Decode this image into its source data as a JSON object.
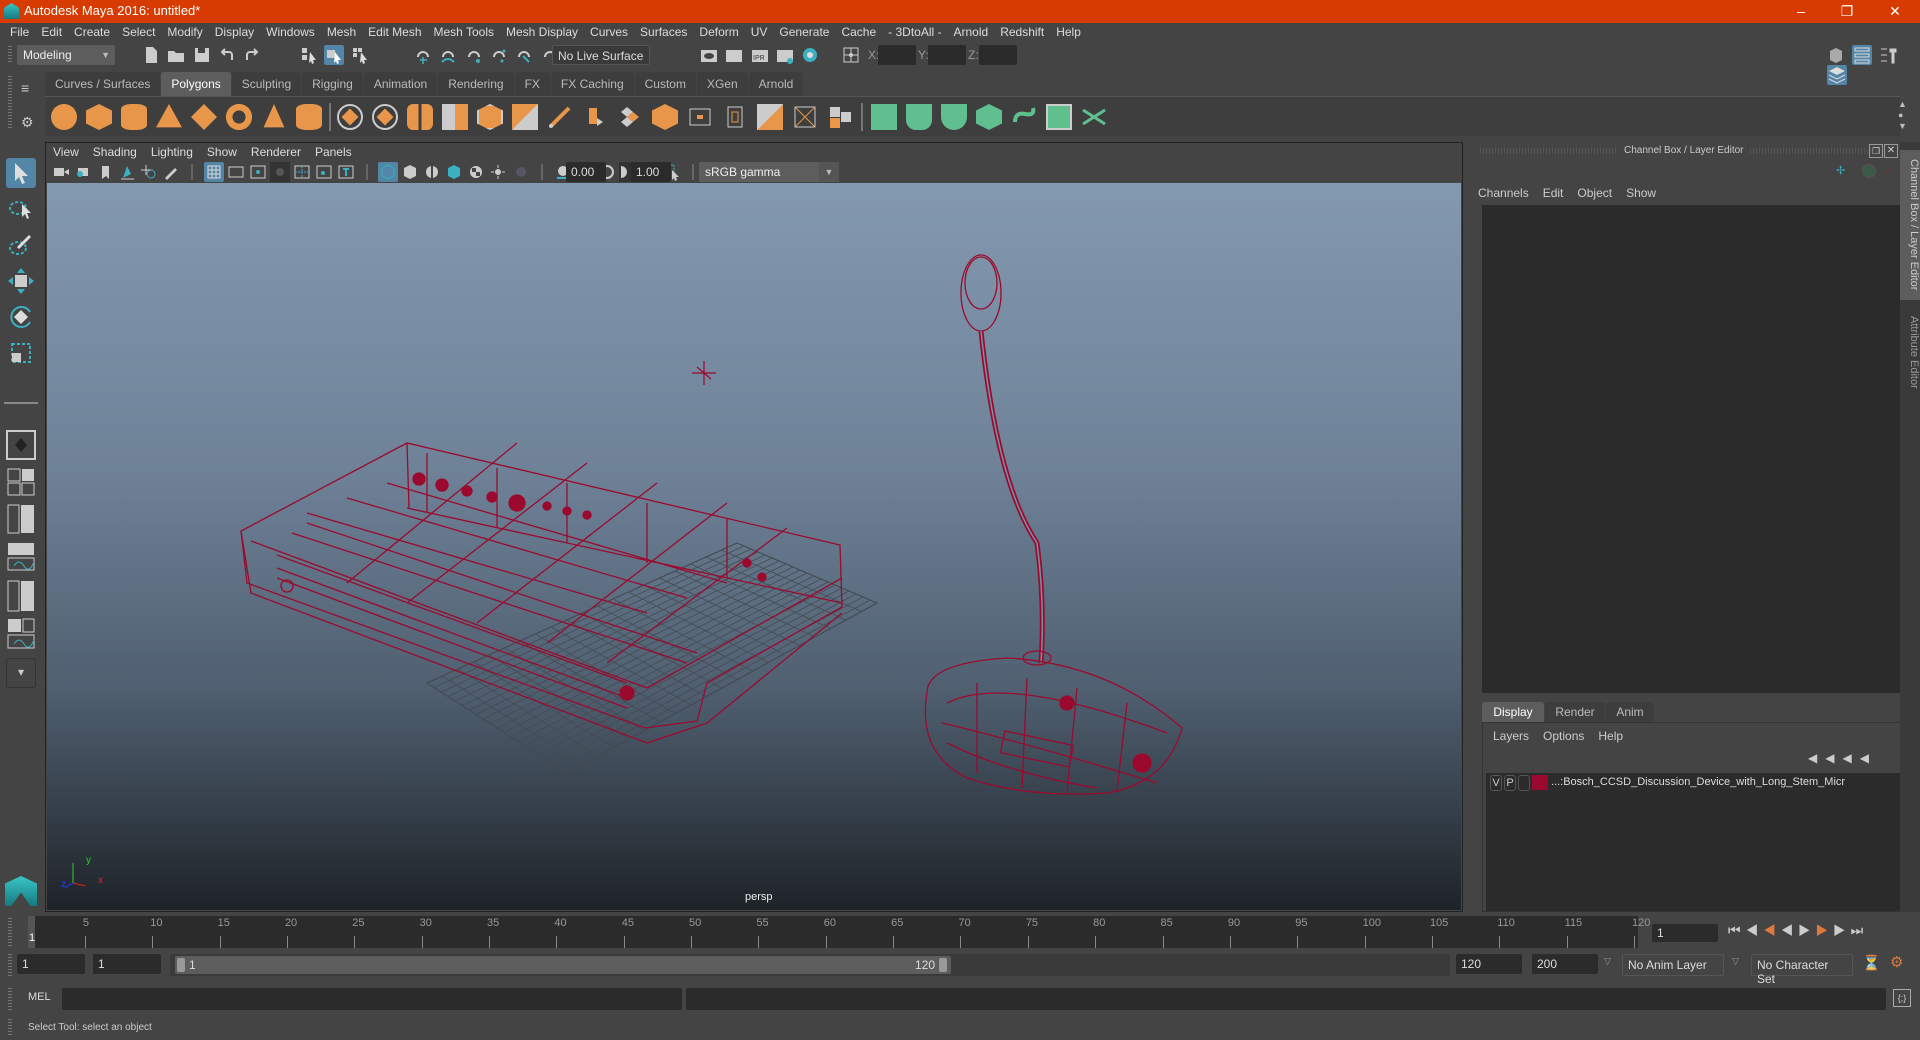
{
  "window": {
    "title": "Autodesk Maya 2016: untitled*",
    "controls": [
      "minimize",
      "restore",
      "close"
    ]
  },
  "menubar": [
    "File",
    "Edit",
    "Create",
    "Select",
    "Modify",
    "Display",
    "Windows",
    "Mesh",
    "Edit Mesh",
    "Mesh Tools",
    "Mesh Display",
    "Curves",
    "Surfaces",
    "Deform",
    "UV",
    "Generate",
    "Cache",
    "- 3DtoAll -",
    "Arnold",
    "Redshift",
    "Help"
  ],
  "statusline": {
    "mode": "Modeling",
    "live_surface": "No Live Surface",
    "x_label": "X:",
    "y_label": "Y:",
    "z_label": "Z:",
    "x": "",
    "y": "",
    "z": ""
  },
  "shelf": {
    "tabs": [
      "Curves / Surfaces",
      "Polygons",
      "Sculpting",
      "Rigging",
      "Animation",
      "Rendering",
      "FX",
      "FX Caching",
      "Custom",
      "XGen",
      "Arnold"
    ],
    "active_tab": "Polygons",
    "icons": [
      "poly-sphere",
      "poly-cube",
      "poly-cylinder",
      "poly-cone",
      "poly-diamond",
      "poly-torus",
      "poly-pyramid",
      "poly-pipe",
      "combine",
      "separate",
      "extract",
      "smooth",
      "booleans",
      "mirror",
      "bevel",
      "multi-cut",
      "extrude",
      "bridge",
      "fill-hole",
      "append",
      "bevel-edge",
      "target-weld",
      "append-polygon",
      "planar-uv",
      "cylindrical-uv",
      "spherical-uv",
      "automatic-uv",
      "camera-uv",
      "uv-editor",
      "unfold-uv"
    ]
  },
  "viewport": {
    "menu": [
      "View",
      "Shading",
      "Lighting",
      "Show",
      "Renderer",
      "Panels"
    ],
    "exposure": "0.00",
    "gamma": "1.00",
    "color_space": "sRGB gamma",
    "camera_label": "persp",
    "axis": {
      "x": "x",
      "y": "y",
      "z": "z"
    }
  },
  "right_panel": {
    "title": "Channel Box / Layer Editor",
    "channel_menu": [
      "Channels",
      "Edit",
      "Object",
      "Show"
    ],
    "layer_tabs": [
      "Display",
      "Render",
      "Anim"
    ],
    "active_layer_tab": "Display",
    "layer_menu": [
      "Layers",
      "Options",
      "Help"
    ],
    "layers": [
      {
        "v": "V",
        "p": "P",
        "color": "#9b0a2e",
        "name": "...:Bosch_CCSD_Discussion_Device_with_Long_Stem_Micr"
      }
    ]
  },
  "side_tabs": [
    "Channel Box / Layer Editor",
    "Attribute Editor"
  ],
  "timeline": {
    "ticks": [
      5,
      10,
      15,
      20,
      25,
      30,
      35,
      40,
      45,
      50,
      55,
      60,
      65,
      70,
      75,
      80,
      85,
      90,
      95,
      100,
      105,
      110,
      115,
      120
    ],
    "current_frame": "1",
    "current_frame_field": "1"
  },
  "range": {
    "start": "1",
    "playback_start": "1",
    "slider_start": "1",
    "slider_end": "120",
    "playback_end": "120",
    "end": "200",
    "anim_layer": "No Anim Layer",
    "character_set": "No Character Set"
  },
  "command_line": {
    "label": "MEL",
    "value": ""
  },
  "help_line": "Select Tool: select an object",
  "colors": {
    "titlebar": "#d83b01",
    "wireframe": "#9b0a2e",
    "accent": "#5285a6",
    "shelf_orange": "#e8964a",
    "shelf_green": "#5fbf8f"
  }
}
